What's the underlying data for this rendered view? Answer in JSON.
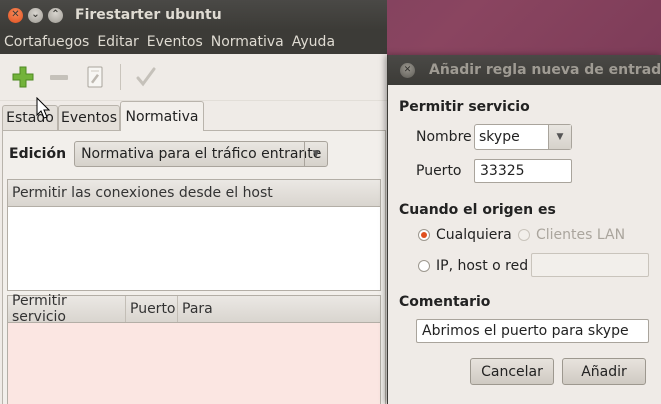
{
  "main_window": {
    "title": "Firestarter ubuntu",
    "menu": [
      "Cortafuegos",
      "Editar",
      "Eventos",
      "Normativa",
      "Ayuda"
    ],
    "toolbar": {
      "icons": [
        "add-icon",
        "remove-icon",
        "edit-icon",
        "apply-icon"
      ]
    },
    "tabs": [
      "Estado",
      "Eventos",
      "Normativa"
    ],
    "active_tab": "Normativa",
    "edition_label": "Edición",
    "edition_value": "Normativa para el tráfico entrante",
    "inbound_hosts_header": "Permitir las conexiones desde el host",
    "service_columns": [
      "Permitir servicio",
      "Puerto",
      "Para"
    ]
  },
  "dialog": {
    "title": "Añadir regla nueva de entrad",
    "service_section": "Permitir servicio",
    "name_label": "Nombre",
    "name_value": "skype",
    "port_label": "Puerto",
    "port_value": "33325",
    "origin_section": "Cuando el origen es",
    "origin_options": {
      "any": "Cualquiera",
      "lan": "Clientes LAN",
      "ip": "IP, host o red"
    },
    "origin_selected": "Cualquiera",
    "ip_value": "",
    "comment_section": "Comentario",
    "comment_value": "Abrimos el puerto para skype",
    "cancel_label": "Cancelar",
    "add_label": "Añadir"
  },
  "colors": {
    "accent": "#e0501f",
    "titlebar": "#3c3b37",
    "window_bg": "#efebe7",
    "list_pink": "#fbe6e2"
  }
}
